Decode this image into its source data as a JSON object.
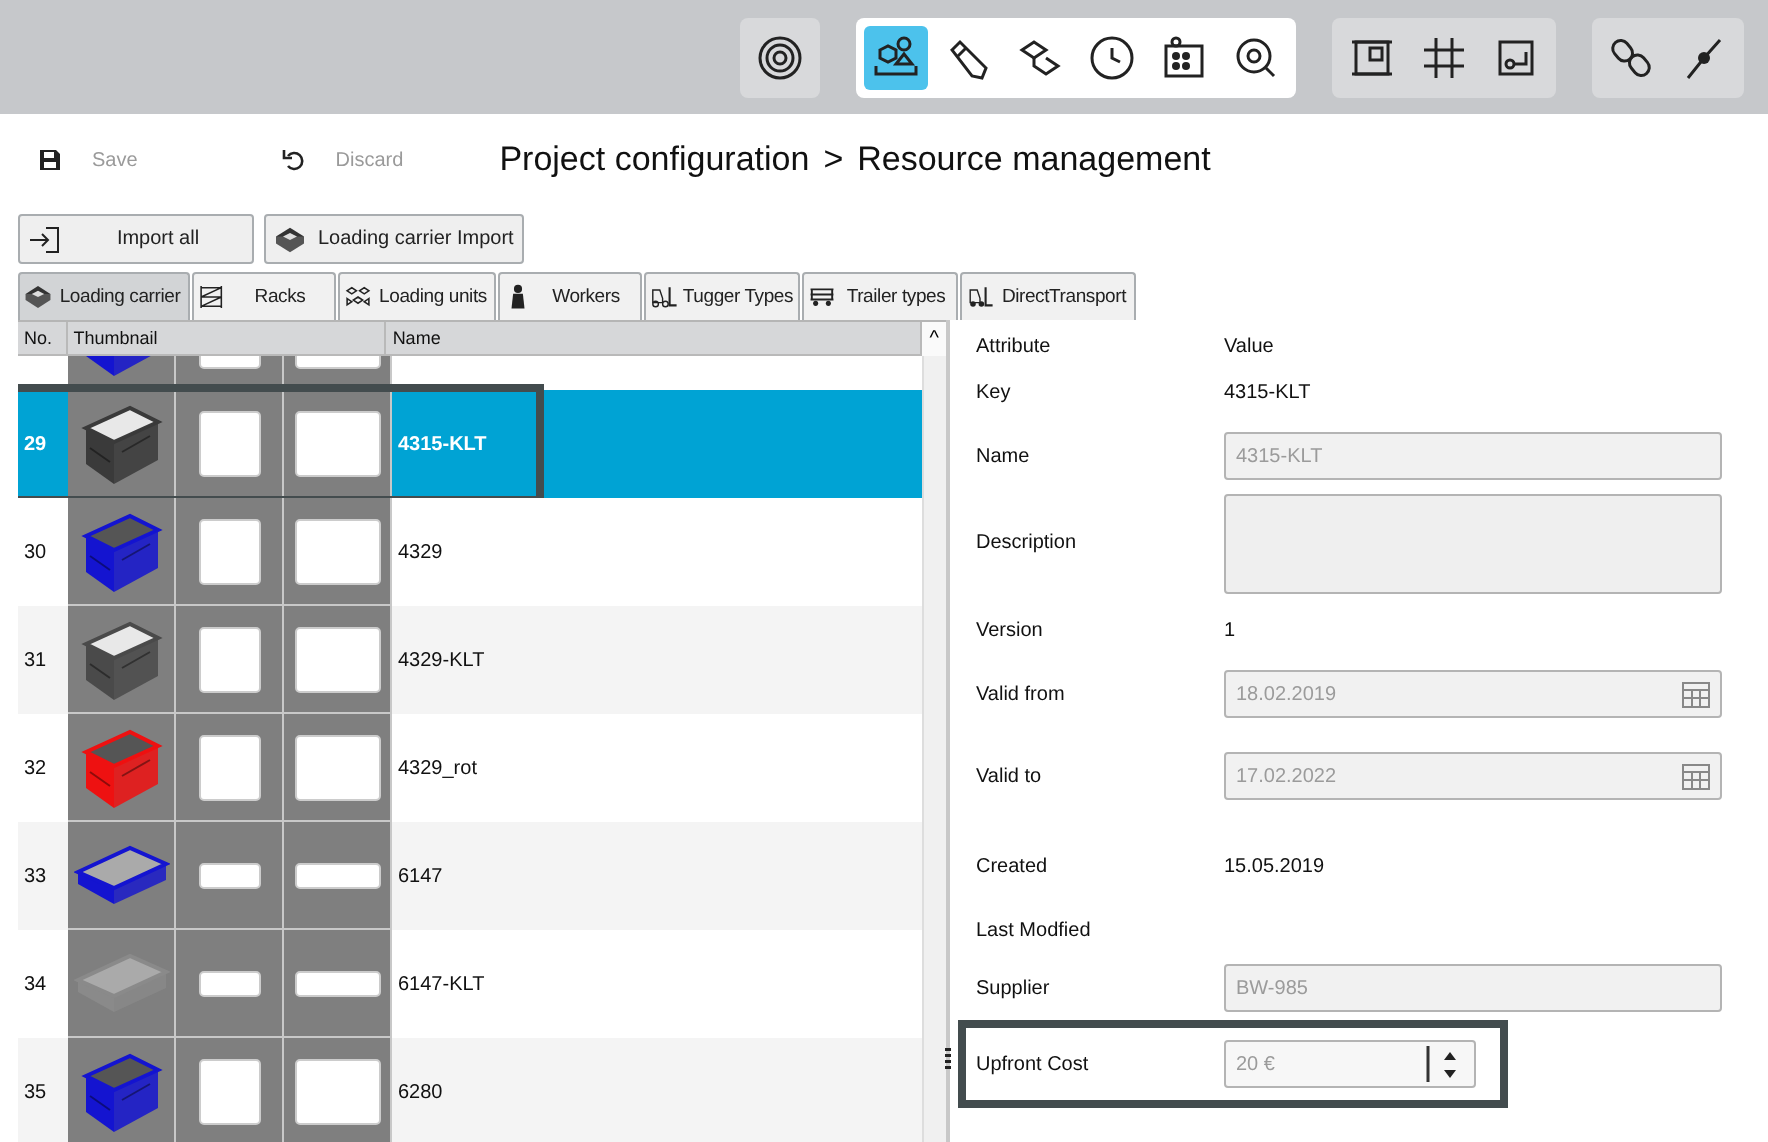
{
  "toolbar": {
    "groups": [
      {
        "tools": [
          {
            "selected": false
          }
        ]
      },
      {
        "tools": [
          {
            "selected": true
          },
          {
            "selected": false
          },
          {
            "selected": false
          },
          {
            "selected": false
          },
          {
            "selected": false
          },
          {
            "selected": false
          }
        ]
      },
      {
        "tools": [
          {
            "selected": false
          },
          {
            "selected": false
          },
          {
            "selected": false
          }
        ]
      },
      {
        "tools": [
          {
            "selected": false
          },
          {
            "selected": false
          }
        ]
      }
    ]
  },
  "actions": [
    {
      "label": "Save",
      "disabled": true
    },
    {
      "label": "Discard",
      "disabled": true
    }
  ],
  "breadcrumb": {
    "parent": "Project configuration",
    "separator": ">",
    "current": "Resource management"
  },
  "import_buttons": [
    "Import all",
    "Loading carrier Import"
  ],
  "tabs": [
    {
      "label": "Loading carrier",
      "selected": true
    },
    {
      "label": "Racks",
      "selected": false
    },
    {
      "label": "Loading units",
      "selected": false
    },
    {
      "label": "Workers",
      "selected": false
    },
    {
      "label": "Tugger Types",
      "selected": false
    },
    {
      "label": "Trailer types",
      "selected": false
    },
    {
      "label": "DirectTransport",
      "selected": false
    }
  ],
  "table": {
    "columns": [
      "No.",
      "Thumbnail",
      "Name"
    ],
    "scroll_up": "^",
    "rows": [
      {
        "kind": "crate",
        "color": "#1414d0",
        "selected": false,
        "outlined": false
      },
      {
        "number": "29",
        "name": "4315-KLT",
        "kind": "lidded",
        "color": "#3a3a3a",
        "selected": true,
        "outlined": true
      },
      {
        "number": "30",
        "name": "4329",
        "kind": "crate",
        "color": "#1414d0",
        "selected": false,
        "outlined": false
      },
      {
        "number": "31",
        "name": "4329-KLT",
        "kind": "lidded",
        "color": "#4a4a4a",
        "selected": false,
        "outlined": false
      },
      {
        "number": "32",
        "name": "4329_rot",
        "kind": "crate",
        "color": "#ee1111",
        "selected": false,
        "outlined": false
      },
      {
        "number": "33",
        "name": "6147",
        "kind": "tray",
        "color": "#1414d0",
        "selected": false,
        "outlined": false
      },
      {
        "number": "34",
        "name": "6147-KLT",
        "kind": "tray",
        "color": "#8a8a8a",
        "selected": false,
        "outlined": false
      },
      {
        "number": "35",
        "name": "6280",
        "kind": "crate",
        "color": "#1414d0",
        "selected": false,
        "outlined": false
      }
    ]
  },
  "attributes": {
    "columns": [
      "Attribute",
      "Value"
    ],
    "items": [
      {
        "label": "Key",
        "kind": "text",
        "value": "4315-KLT",
        "outlined": false
      },
      {
        "label": "Name",
        "kind": "field",
        "value": "4315-KLT",
        "disabled": true,
        "outlined": false
      },
      {
        "label": "Description",
        "kind": "area",
        "outlined": false
      },
      {
        "label": "Version",
        "kind": "text",
        "value": "1",
        "outlined": false
      },
      {
        "label": "Valid from",
        "kind": "date",
        "value": "18.02.2019",
        "disabled": true,
        "outlined": false
      },
      {
        "label": "Valid to",
        "kind": "date",
        "value": "17.02.2022",
        "disabled": true,
        "outlined": false
      },
      {
        "label": "Created",
        "kind": "text",
        "value": "15.05.2019",
        "outlined": false
      },
      {
        "label": "Last Modfied",
        "kind": "empty",
        "outlined": false
      },
      {
        "label": "Supplier",
        "kind": "field",
        "value": "BW-985",
        "disabled": true,
        "outlined": false
      },
      {
        "label": "Upfront Cost",
        "kind": "spin",
        "value": "20 €",
        "disabled": true,
        "outlined": true
      }
    ]
  }
}
